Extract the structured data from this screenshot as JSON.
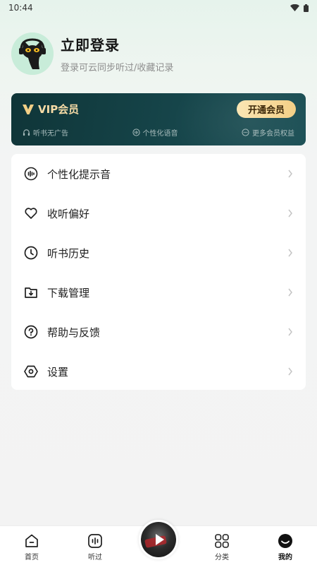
{
  "status_bar": {
    "time": "10:44"
  },
  "profile": {
    "title": "立即登录",
    "subtitle": "登录可云同步听过/收藏记录"
  },
  "vip": {
    "title": "VIP会员",
    "button_label": "开通会员",
    "accent_color": "#f6dba6",
    "benefits": [
      {
        "icon": "headphones-icon",
        "label": "听书无广告"
      },
      {
        "icon": "voice-icon",
        "label": "个性化语音"
      },
      {
        "icon": "more-dots-icon",
        "label": "更多会员权益"
      }
    ]
  },
  "menu": [
    {
      "icon": "voice-wave-icon",
      "label": "个性化提示音"
    },
    {
      "icon": "heart-icon",
      "label": "收听偏好"
    },
    {
      "icon": "clock-icon",
      "label": "听书历史"
    },
    {
      "icon": "download-folder-icon",
      "label": "下载管理"
    },
    {
      "icon": "help-icon",
      "label": "帮助与反馈"
    },
    {
      "icon": "settings-hexagon-icon",
      "label": "设置"
    }
  ],
  "tabs": [
    {
      "icon": "home-icon",
      "label": "首页"
    },
    {
      "icon": "listened-icon",
      "label": "听过"
    },
    {
      "icon": "category-icon",
      "label": "分类"
    },
    {
      "icon": "profile-icon",
      "label": "我的",
      "active": true
    }
  ]
}
